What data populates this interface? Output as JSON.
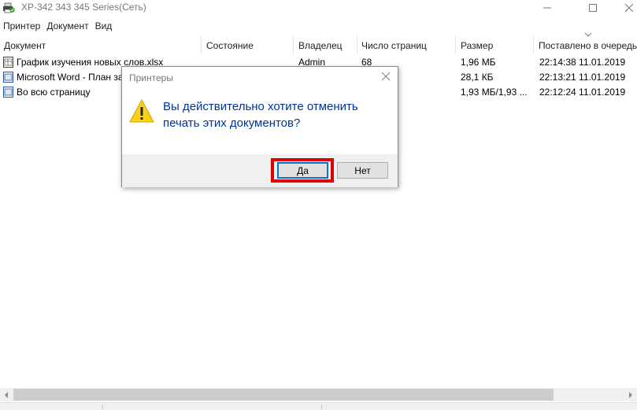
{
  "window": {
    "title": "XP-342 343 345 Series(Сеть)"
  },
  "menu": [
    "Принтер",
    "Документ",
    "Вид"
  ],
  "columns": [
    "Документ",
    "Состояние",
    "Владелец",
    "Число страниц",
    "Размер",
    "Поставлено в очередь"
  ],
  "rows": [
    {
      "document": "График изучения новых слов.xlsx",
      "status": "",
      "owner": "Admin",
      "pages": "68",
      "size": "1,96 МБ",
      "queued": "22:14:38  11.01.2019"
    },
    {
      "document": "Microsoft Word - План за",
      "status": "",
      "owner": "",
      "pages": "",
      "size": "28,1 КБ",
      "queued": "22:13:21  11.01.2019"
    },
    {
      "document": "Во всю страницу",
      "status": "",
      "owner": "",
      "pages": "",
      "size": "1,93 МБ/1,93 ...",
      "queued": "22:12:24  11.01.2019"
    }
  ],
  "dialog": {
    "title": "Принтеры",
    "message_line1": "Вы действительно хотите отменить",
    "message_line2": "печать этих документов?",
    "yes_label": "Да",
    "no_label": "Нет"
  },
  "colors": {
    "message_text": "#003399",
    "highlight": "#e00000",
    "focus_border": "#0078d7"
  },
  "icons": {
    "app": "printer-icon",
    "warning": "warning-icon",
    "doc": "document-icon"
  }
}
